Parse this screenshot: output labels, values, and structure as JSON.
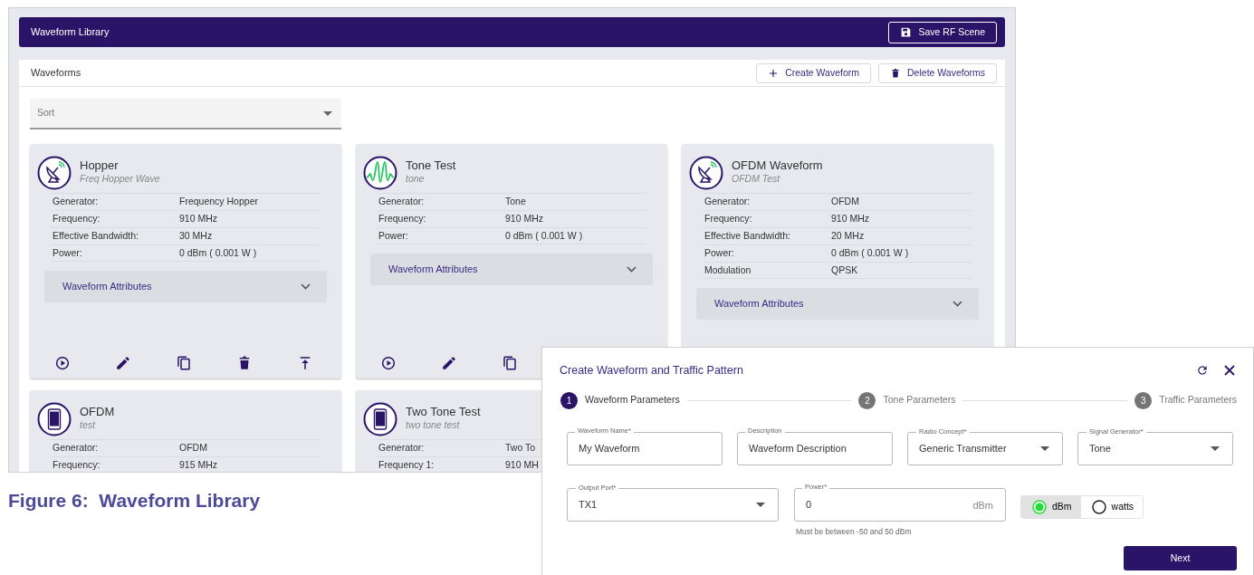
{
  "library": {
    "title": "Waveform Library",
    "save_button": "Save RF Scene"
  },
  "panel": {
    "title": "Waveforms",
    "buttons": [
      {
        "kind": "create",
        "label": "Create Waveform"
      },
      {
        "kind": "delete",
        "label": "Delete Waveforms"
      }
    ]
  },
  "sort": {
    "placeholder": "Sort"
  },
  "cards": [
    {
      "kind": "dish",
      "name": "Hopper",
      "description": "Freq Hopper Wave",
      "rows": [
        {
          "label": "Generator:",
          "value": "Frequency Hopper"
        },
        {
          "label": "Frequency:",
          "value": "910 MHz"
        },
        {
          "label": "Effective Bandwidth:",
          "value": "30 MHz"
        },
        {
          "label": "Power:",
          "value": "0 dBm ( 0.001 W )"
        }
      ],
      "attributes": "Waveform Attributes",
      "actions": [
        {
          "kind": "play"
        },
        {
          "kind": "edit"
        },
        {
          "kind": "copy"
        },
        {
          "kind": "delete"
        },
        {
          "kind": "top"
        }
      ]
    },
    {
      "kind": "tone",
      "name": "Tone Test",
      "description": "tone",
      "rows": [
        {
          "label": "Generator:",
          "value": "Tone"
        },
        {
          "label": "Frequency:",
          "value": "910 MHz"
        },
        {
          "label": "Power:",
          "value": "0 dBm ( 0.001 W )"
        }
      ],
      "attributes": "Waveform Attributes",
      "actions": [
        {
          "kind": "play"
        },
        {
          "kind": "edit"
        },
        {
          "kind": "copy"
        }
      ]
    },
    {
      "kind": "dish",
      "name": "OFDM Waveform",
      "description": "OFDM Test",
      "rows": [
        {
          "label": "Generator:",
          "value": "OFDM"
        },
        {
          "label": "Frequency:",
          "value": "910 MHz"
        },
        {
          "label": "Effective Bandwidth:",
          "value": "20 MHz"
        },
        {
          "label": "Power:",
          "value": "0 dBm ( 0.001 W )"
        },
        {
          "label": "Modulation",
          "value": "QPSK"
        }
      ],
      "attributes": "Waveform Attributes"
    },
    {
      "kind": "device",
      "name": "OFDM",
      "description": "test",
      "rows": [
        {
          "label": "Generator:",
          "value": "OFDM"
        },
        {
          "label": "Frequency:",
          "value": "915 MHz"
        }
      ]
    },
    {
      "kind": "device",
      "name": "Two Tone Test",
      "description": "two tone test",
      "rows": [
        {
          "label": "Generator:",
          "value": "Two To"
        },
        {
          "label": "Frequency 1:",
          "value": "910 MH"
        }
      ]
    }
  ],
  "caption": "Figure 6:  Waveform Library",
  "dialog": {
    "title": "Create Waveform and Traffic Pattern",
    "steps": [
      {
        "number": "1",
        "label": "Waveform Parameters",
        "selected": true
      },
      {
        "number": "2",
        "label": "Tone Parameters",
        "selected": false
      },
      {
        "number": "3",
        "label": "Traffic Parameters",
        "selected": false
      }
    ],
    "field_rows": [
      [
        {
          "kind": "text",
          "label": "Waveform Name*",
          "value": "My Waveform"
        },
        {
          "kind": "text",
          "label": "Description",
          "value": "Waveform Description"
        },
        {
          "kind": "select",
          "label": "Radio Concept*",
          "value": "Generic Transmitter"
        },
        {
          "kind": "select",
          "label": "Signal Generator*",
          "value": "Tone"
        }
      ],
      [
        {
          "kind": "select",
          "label": "Output Port*",
          "value": "TX1"
        },
        {
          "kind": "text",
          "label": "Power*",
          "value": "0",
          "unit": "dBm",
          "hint": "Must be between -50 and 50 dBm"
        }
      ]
    ],
    "units": [
      {
        "label": "dBm",
        "selected": true
      },
      {
        "label": "watts",
        "selected": false
      }
    ],
    "next_button": "Next"
  }
}
